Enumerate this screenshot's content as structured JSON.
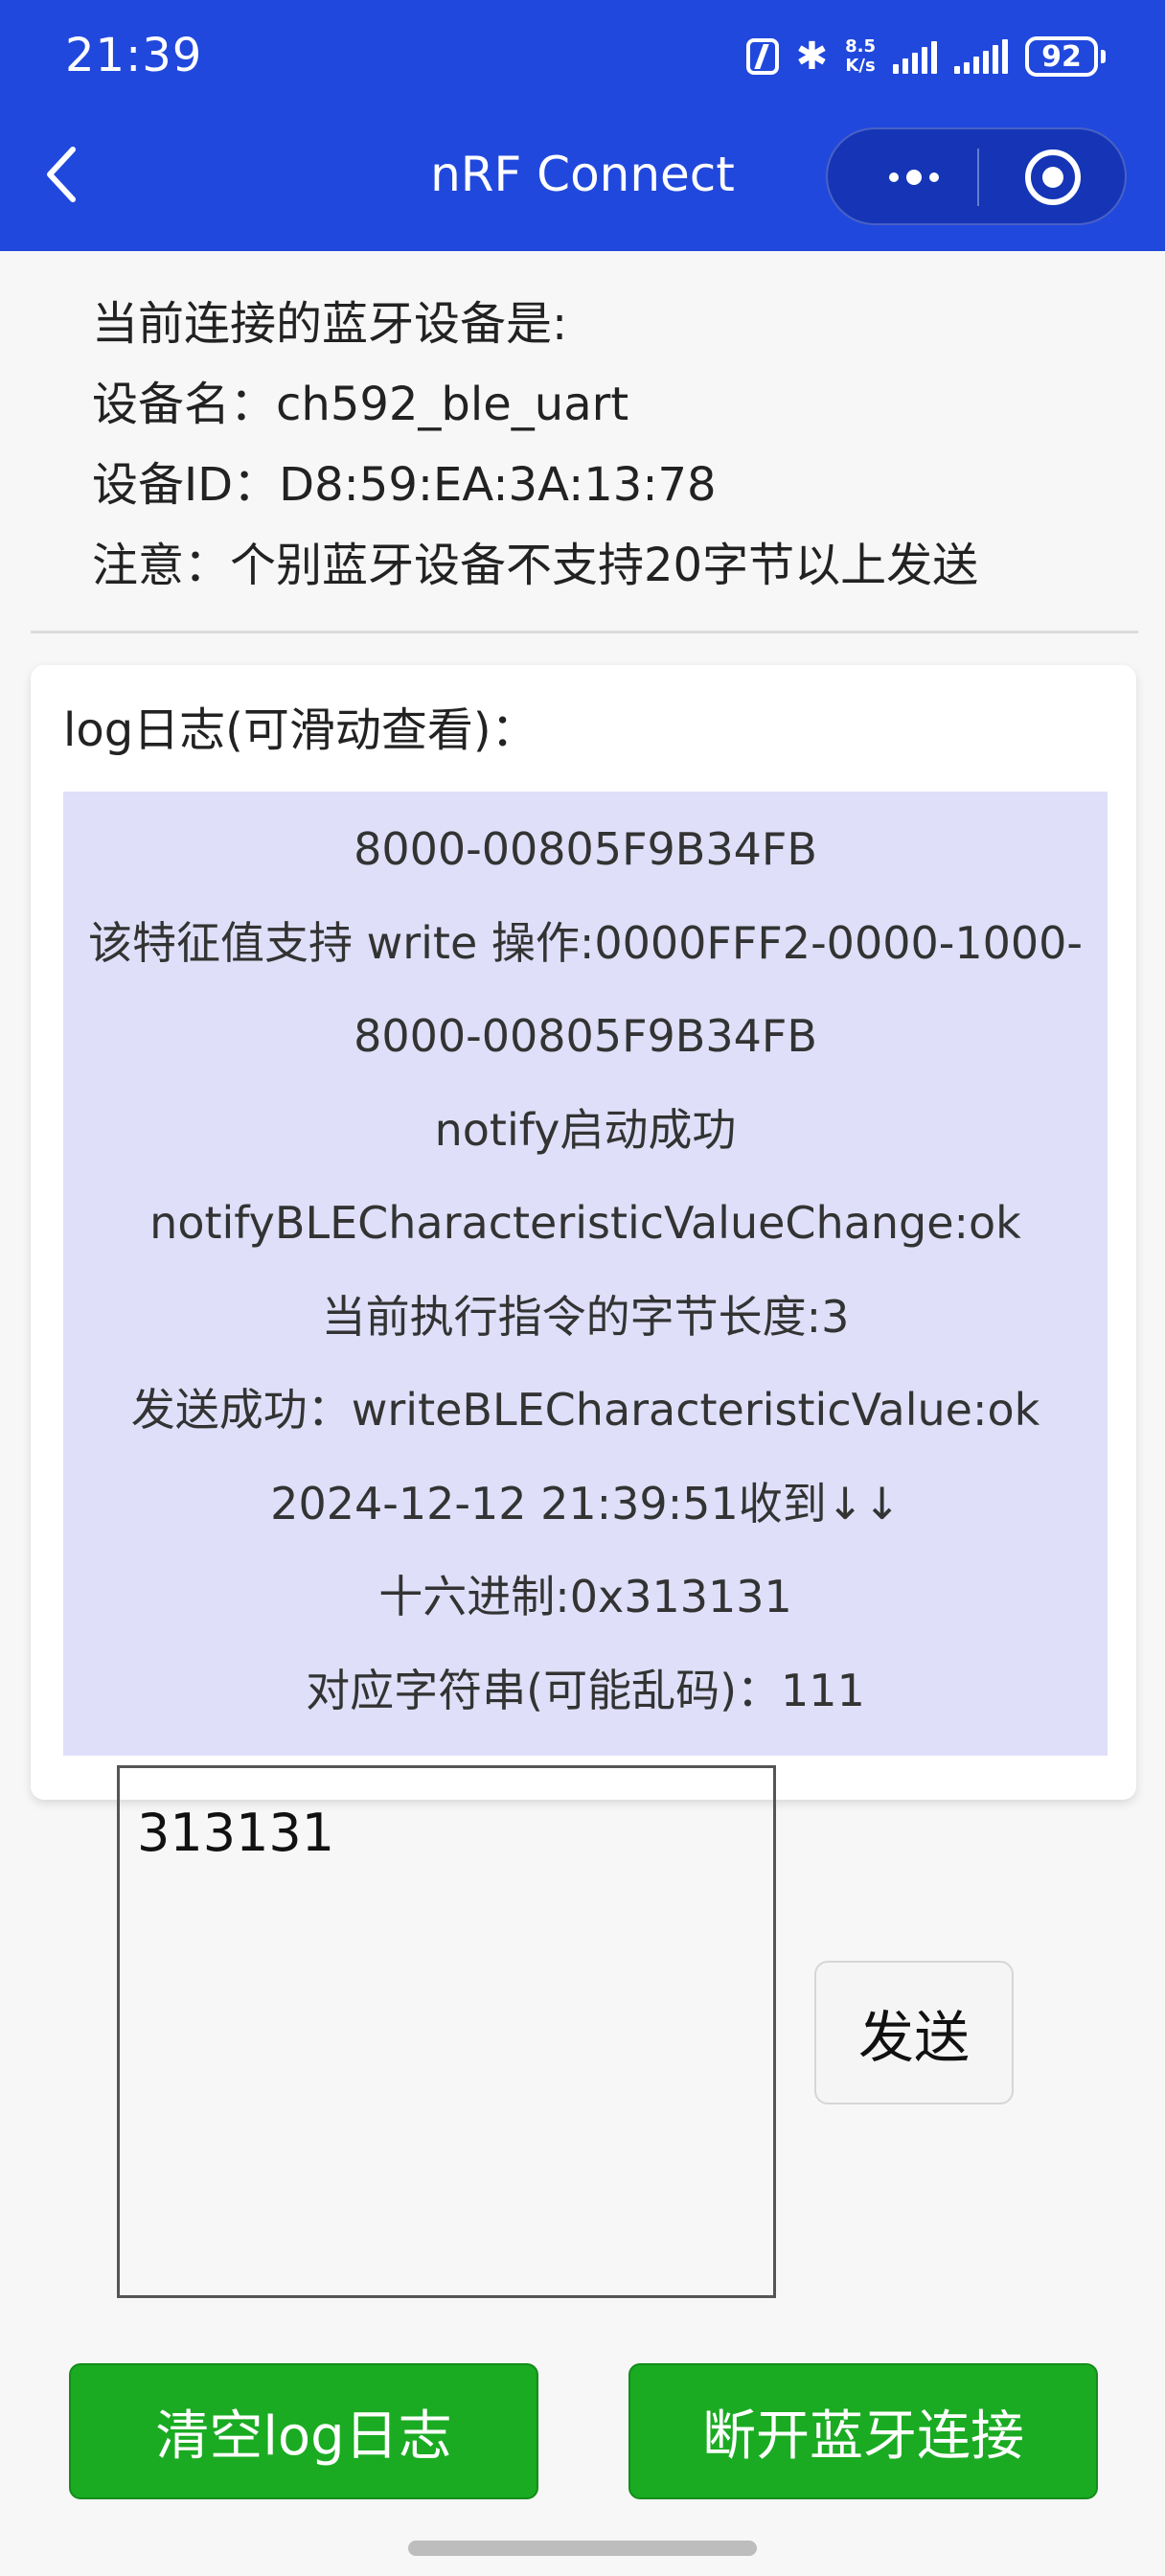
{
  "status_bar": {
    "time": "21:39",
    "net_speed_value": "8.5",
    "net_speed_unit": "K/s",
    "battery": "92"
  },
  "nav": {
    "title": "nRF Connect"
  },
  "device": {
    "heading": "当前连接的蓝牙设备是:",
    "name_line": "设备名：ch592_ble_uart",
    "id_line": "设备ID：D8:59:EA:3A:13:78",
    "note_line": "注意：个别蓝牙设备不支持20字节以上发送"
  },
  "log": {
    "title": "log日志(可滑动查看)：",
    "lines": [
      "8000-00805F9B34FB",
      "该特征值支持 write 操作:0000FFF2-0000-1000-",
      "8000-00805F9B34FB",
      "notify启动成功",
      "notifyBLECharacteristicValueChange:ok",
      "当前执行指令的字节长度:3",
      "发送成功：writeBLECharacteristicValue:ok",
      "2024-12-12 21:39:51收到↓↓",
      "十六进制:0x313131",
      "对应字符串(可能乱码)：111"
    ]
  },
  "input": {
    "value": "313131"
  },
  "buttons": {
    "send": "发送",
    "clear_log": "清空log日志",
    "disconnect": "断开蓝牙连接"
  },
  "colors": {
    "header_bg": "#2148dd",
    "log_bg": "#dfdff9",
    "button_green": "#1aab22"
  }
}
